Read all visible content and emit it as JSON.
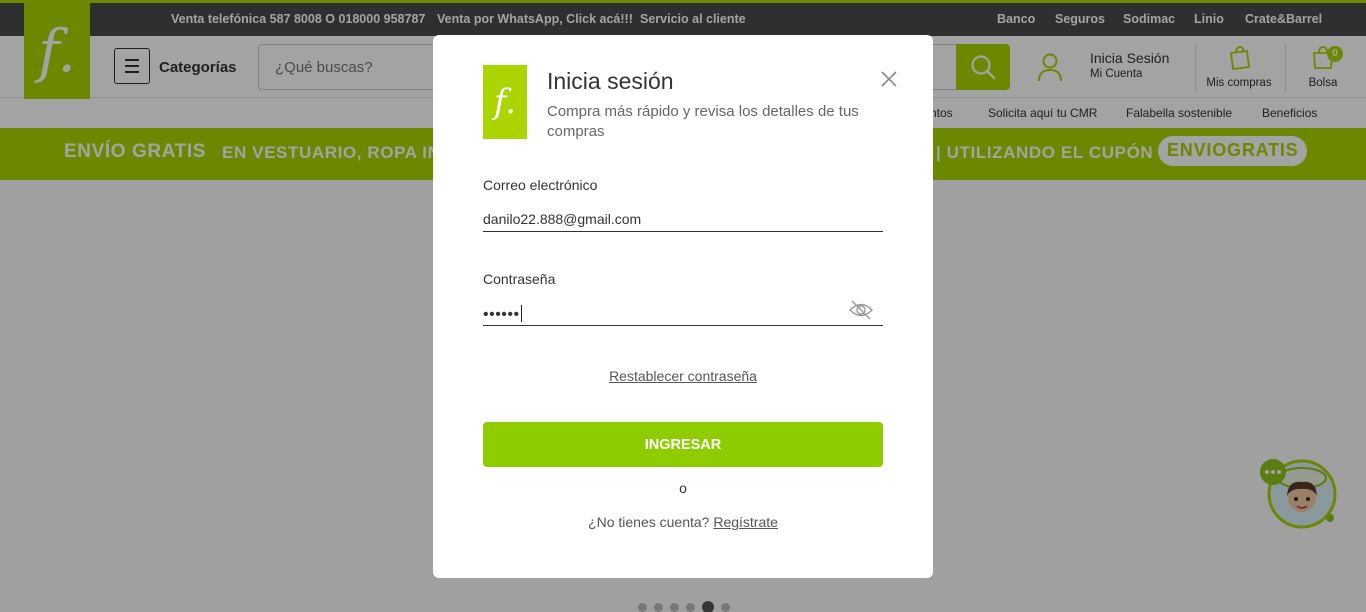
{
  "topbar": {
    "phone": "Venta telefónica 587 8008 O 018000 958787",
    "whatsapp": "Venta por WhatsApp, Click acá!!!",
    "service": "Servicio al cliente",
    "links": [
      "Banco",
      "Seguros",
      "Sodimac",
      "Linio",
      "Crate&Barrel"
    ]
  },
  "brand": {
    "logo_glyph": "f.",
    "accent_color": "#aad500"
  },
  "header": {
    "categories_label": "Categorías",
    "search_placeholder": "¿Qué buscas?",
    "login_title": "Inicia Sesión",
    "login_sub": "Mi Cuenta",
    "purchases_label": "Mis compras",
    "bag_label": "Bolsa",
    "bag_count": "0"
  },
  "subnav": {
    "items": [
      "ntos",
      "Solicita aquí tu CMR",
      "Falabella sostenible",
      "Beneficios"
    ]
  },
  "promo": {
    "free": "ENVÍO GRATIS",
    "text": "EN VESTUARIO, ROPA INT",
    "use": "| UTILIZANDO EL CUPÓN",
    "coupon": "ENVIOGRATIS"
  },
  "modal": {
    "title": "Inicia sesión",
    "subtitle": "Compra más rápido y revisa los detalles de tus compras",
    "email_label": "Correo electrónico",
    "email_value": "danilo22.888@gmail.com",
    "password_label": "Contraseña",
    "password_mask": "••••••",
    "forgot": "Restablecer contraseña",
    "submit": "INGRESAR",
    "or": "o",
    "no_account": "¿No tienes cuenta?",
    "register": "Regístrate"
  },
  "carousel": {
    "slides": 6,
    "active": 5
  },
  "icons": [
    "menu-icon",
    "search-icon",
    "user-icon",
    "shopping-bag-icon",
    "bag-icon",
    "close-icon",
    "eye-off-icon",
    "chat-assistant-icon"
  ]
}
